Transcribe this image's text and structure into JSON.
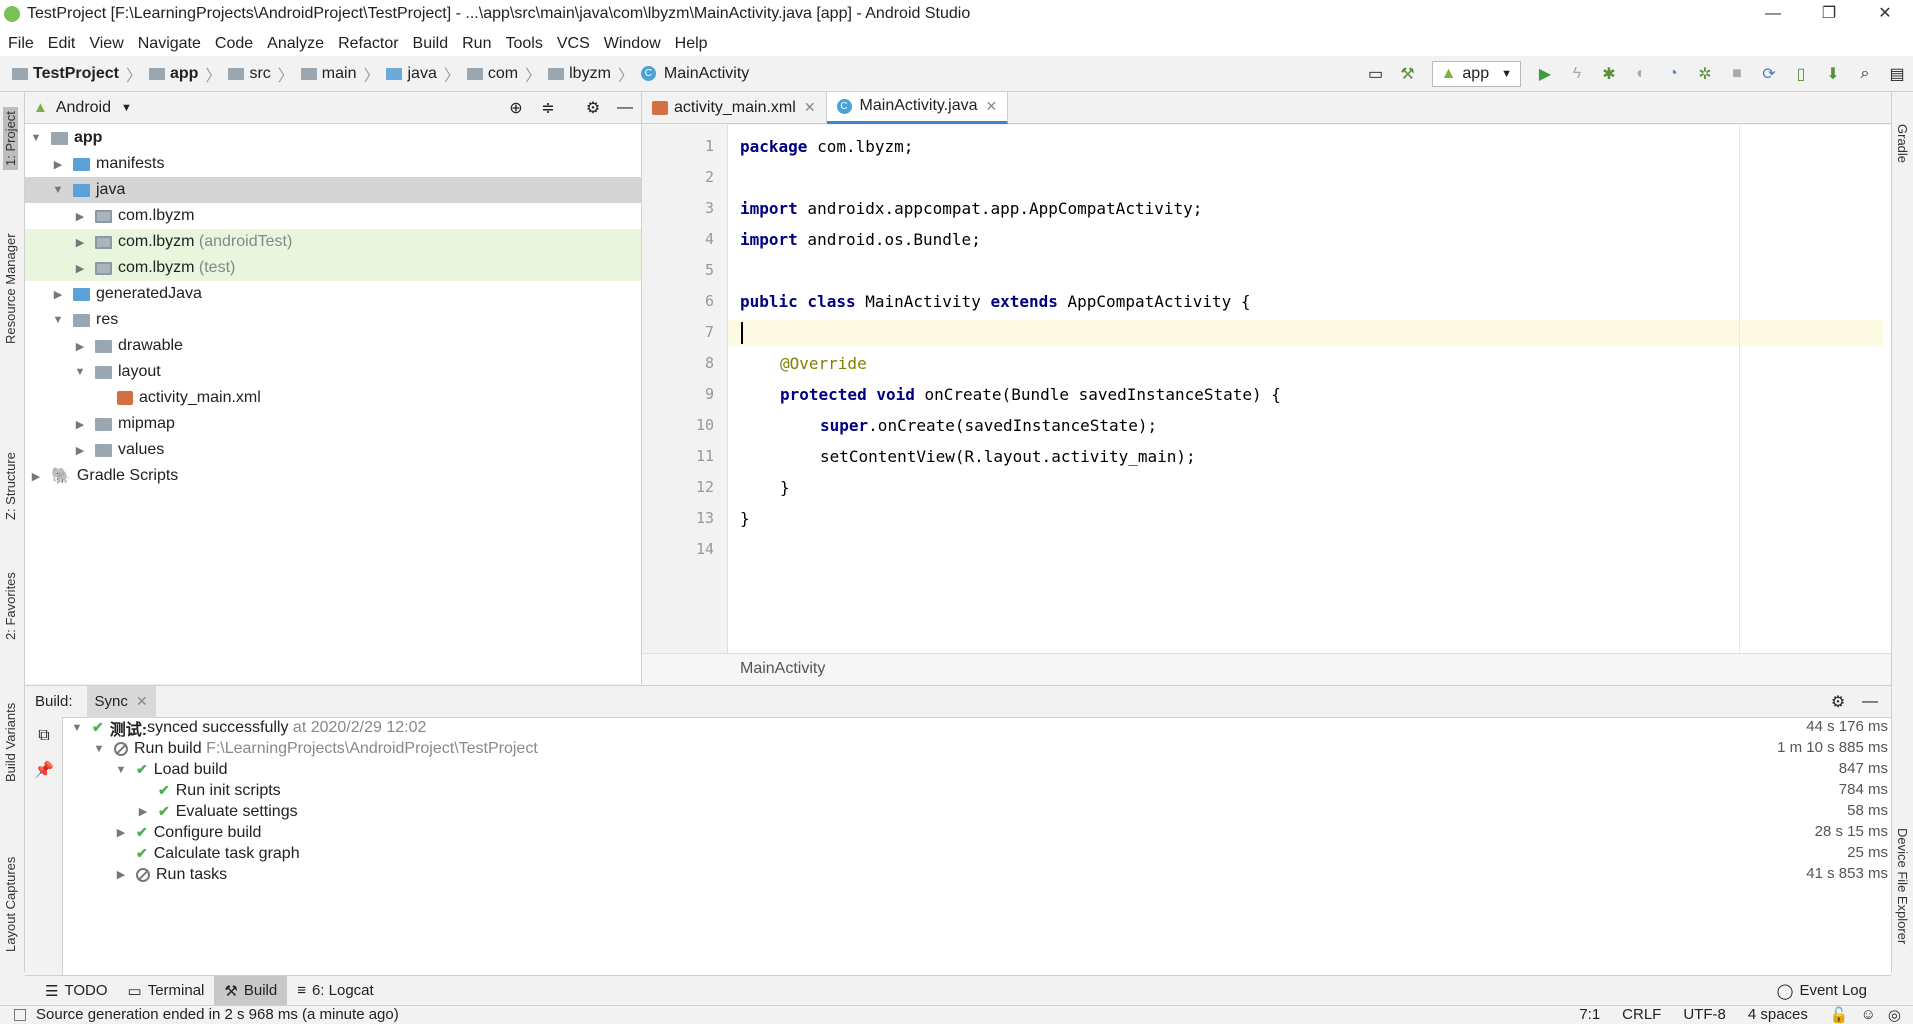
{
  "window": {
    "title": "TestProject [F:\\LearningProjects\\AndroidProject\\TestProject] - ...\\app\\src\\main\\java\\com\\lbyzm\\MainActivity.java [app] - Android Studio"
  },
  "menu": [
    "File",
    "Edit",
    "View",
    "Navigate",
    "Code",
    "Analyze",
    "Refactor",
    "Build",
    "Run",
    "Tools",
    "VCS",
    "Window",
    "Help"
  ],
  "nav": {
    "crumbs": [
      "TestProject",
      "app",
      "src",
      "main",
      "java",
      "com",
      "lbyzm",
      "MainActivity"
    ],
    "run_config": "app"
  },
  "left_strip": [
    "1: Project",
    "Resource Manager",
    "Z: Structure",
    "2: Favorites",
    "Build Variants",
    "Layout Captures"
  ],
  "right_strip": [
    "Gradle",
    "Device File Explorer"
  ],
  "project": {
    "view": "Android",
    "tree": [
      {
        "label": "app",
        "extra": ""
      },
      {
        "label": "manifests",
        "extra": ""
      },
      {
        "label": "java",
        "extra": ""
      },
      {
        "label": "com.lbyzm",
        "extra": ""
      },
      {
        "label": "com.lbyzm",
        "extra": "(androidTest)"
      },
      {
        "label": "com.lbyzm",
        "extra": "(test)"
      },
      {
        "label": "generatedJava",
        "extra": ""
      },
      {
        "label": "res",
        "extra": ""
      },
      {
        "label": "drawable",
        "extra": ""
      },
      {
        "label": "layout",
        "extra": ""
      },
      {
        "label": "activity_main.xml",
        "extra": ""
      },
      {
        "label": "mipmap",
        "extra": ""
      },
      {
        "label": "values",
        "extra": ""
      },
      {
        "label": "Gradle Scripts",
        "extra": ""
      }
    ]
  },
  "editor": {
    "tabs": [
      "activity_main.xml",
      "MainActivity.java"
    ],
    "line_numbers": [
      "1",
      "2",
      "3",
      "4",
      "5",
      "6",
      "7",
      "8",
      "9",
      "10",
      "11",
      "12",
      "13",
      "14"
    ],
    "lines": {
      "l1_kw": "package",
      "l1_rest": " com.lbyzm;",
      "l3_kw": "import",
      "l3_rest": " androidx.appcompat.app.AppCompatActivity;",
      "l4_kw": "import",
      "l4_rest": " android.os.Bundle;",
      "l6_kw1": "public class",
      "l6_name": " MainActivity ",
      "l6_kw2": "extends",
      "l6_rest": " AppCompatActivity {",
      "l8": "@Override",
      "l9_kw": "protected void",
      "l9_rest": " onCreate(Bundle savedInstanceState) {",
      "l10_kw": "super",
      "l10_rest": ".onCreate(savedInstanceState);",
      "l11": "setContentView(R.layout.activity_main);",
      "l12": "}",
      "l13": "}"
    },
    "footer_breadcrumb": "MainActivity"
  },
  "build": {
    "tab_label": "Build:",
    "sync_tab": "Sync",
    "rows": [
      {
        "label": "测试:",
        "label2": " synced successfully",
        "meta": "at 2020/2/29 12:02",
        "time": "44 s 176 ms"
      },
      {
        "label": "Run build",
        "label2": "",
        "meta": "F:\\LearningProjects\\AndroidProject\\TestProject",
        "time": "1 m 10 s 885 ms"
      },
      {
        "label": "Load build",
        "label2": "",
        "meta": "",
        "time": "847 ms"
      },
      {
        "label": "Run init scripts",
        "label2": "",
        "meta": "",
        "time": "784 ms"
      },
      {
        "label": "Evaluate settings",
        "label2": "",
        "meta": "",
        "time": "58 ms"
      },
      {
        "label": "Configure build",
        "label2": "",
        "meta": "",
        "time": "28 s 15 ms"
      },
      {
        "label": "Calculate task graph",
        "label2": "",
        "meta": "",
        "time": "25 ms"
      },
      {
        "label": "Run tasks",
        "label2": "",
        "meta": "",
        "time": "41 s 853 ms"
      }
    ]
  },
  "tool_tabs": [
    "TODO",
    "Terminal",
    "Build",
    "6: Logcat"
  ],
  "event_log": "Event Log",
  "status": {
    "message": "Source generation ended in 2 s 968 ms (a minute ago)",
    "position": "7:1",
    "line_sep": "CRLF",
    "encoding": "UTF-8",
    "indent": "4 spaces"
  }
}
